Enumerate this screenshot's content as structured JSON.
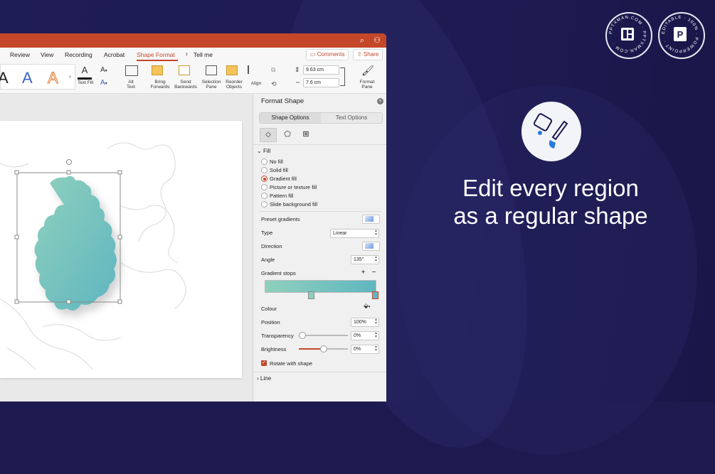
{
  "menu": {
    "items": [
      "Review",
      "View",
      "Recording",
      "Acrobat",
      "Shape Format",
      "Tell me"
    ],
    "comments": "Comments",
    "share": "Share"
  },
  "ribbon": {
    "text_fill": "Text Fill",
    "alt_text": "Alt\nText",
    "bring_forwards": "Bring\nForwards",
    "send_backwards": "Send\nBackwards",
    "selection_pane": "Selection\nPane",
    "reorder_objects": "Reorder\nObjects",
    "align": "Align",
    "height": "9.63 cm",
    "width": "7.6 cm",
    "format_pane": "Format\nPane",
    "wordart_letter": "A"
  },
  "pane": {
    "title": "Format Shape",
    "tab_shape": "Shape Options",
    "tab_text": "Text Options",
    "fill_header": "Fill",
    "fill_options": [
      "No fill",
      "Solid fill",
      "Gradient fill",
      "Picture or texture fill",
      "Pattern fill",
      "Slide background fill"
    ],
    "preset_gradients": "Preset gradients",
    "type_label": "Type",
    "type_value": "Linear",
    "direction_label": "Direction",
    "angle_label": "Angle",
    "angle_value": "135°",
    "gradient_stops": "Gradient stops",
    "colour_label": "Colour",
    "position_label": "Position",
    "position_value": "100%",
    "transparency_label": "Transparency",
    "transparency_value": "0%",
    "brightness_label": "Brightness",
    "brightness_value": "0%",
    "rotate_label": "Rotate with shape",
    "line_header": "Line"
  },
  "headline": {
    "line1": "Edit every region",
    "line2": "as a regular shape"
  },
  "badges": {
    "left_ring": "PPTXMAN.COM · PPTXMAN.COM ·",
    "right_ring": "EDITABLE · 100% · POWERPOINT ·",
    "right_letter": "P"
  },
  "colors": {
    "accent": "#c4472a",
    "background": "#1c1a4e",
    "shape_gradient_start": "#8fd0bd",
    "shape_gradient_end": "#5fb6c0"
  }
}
